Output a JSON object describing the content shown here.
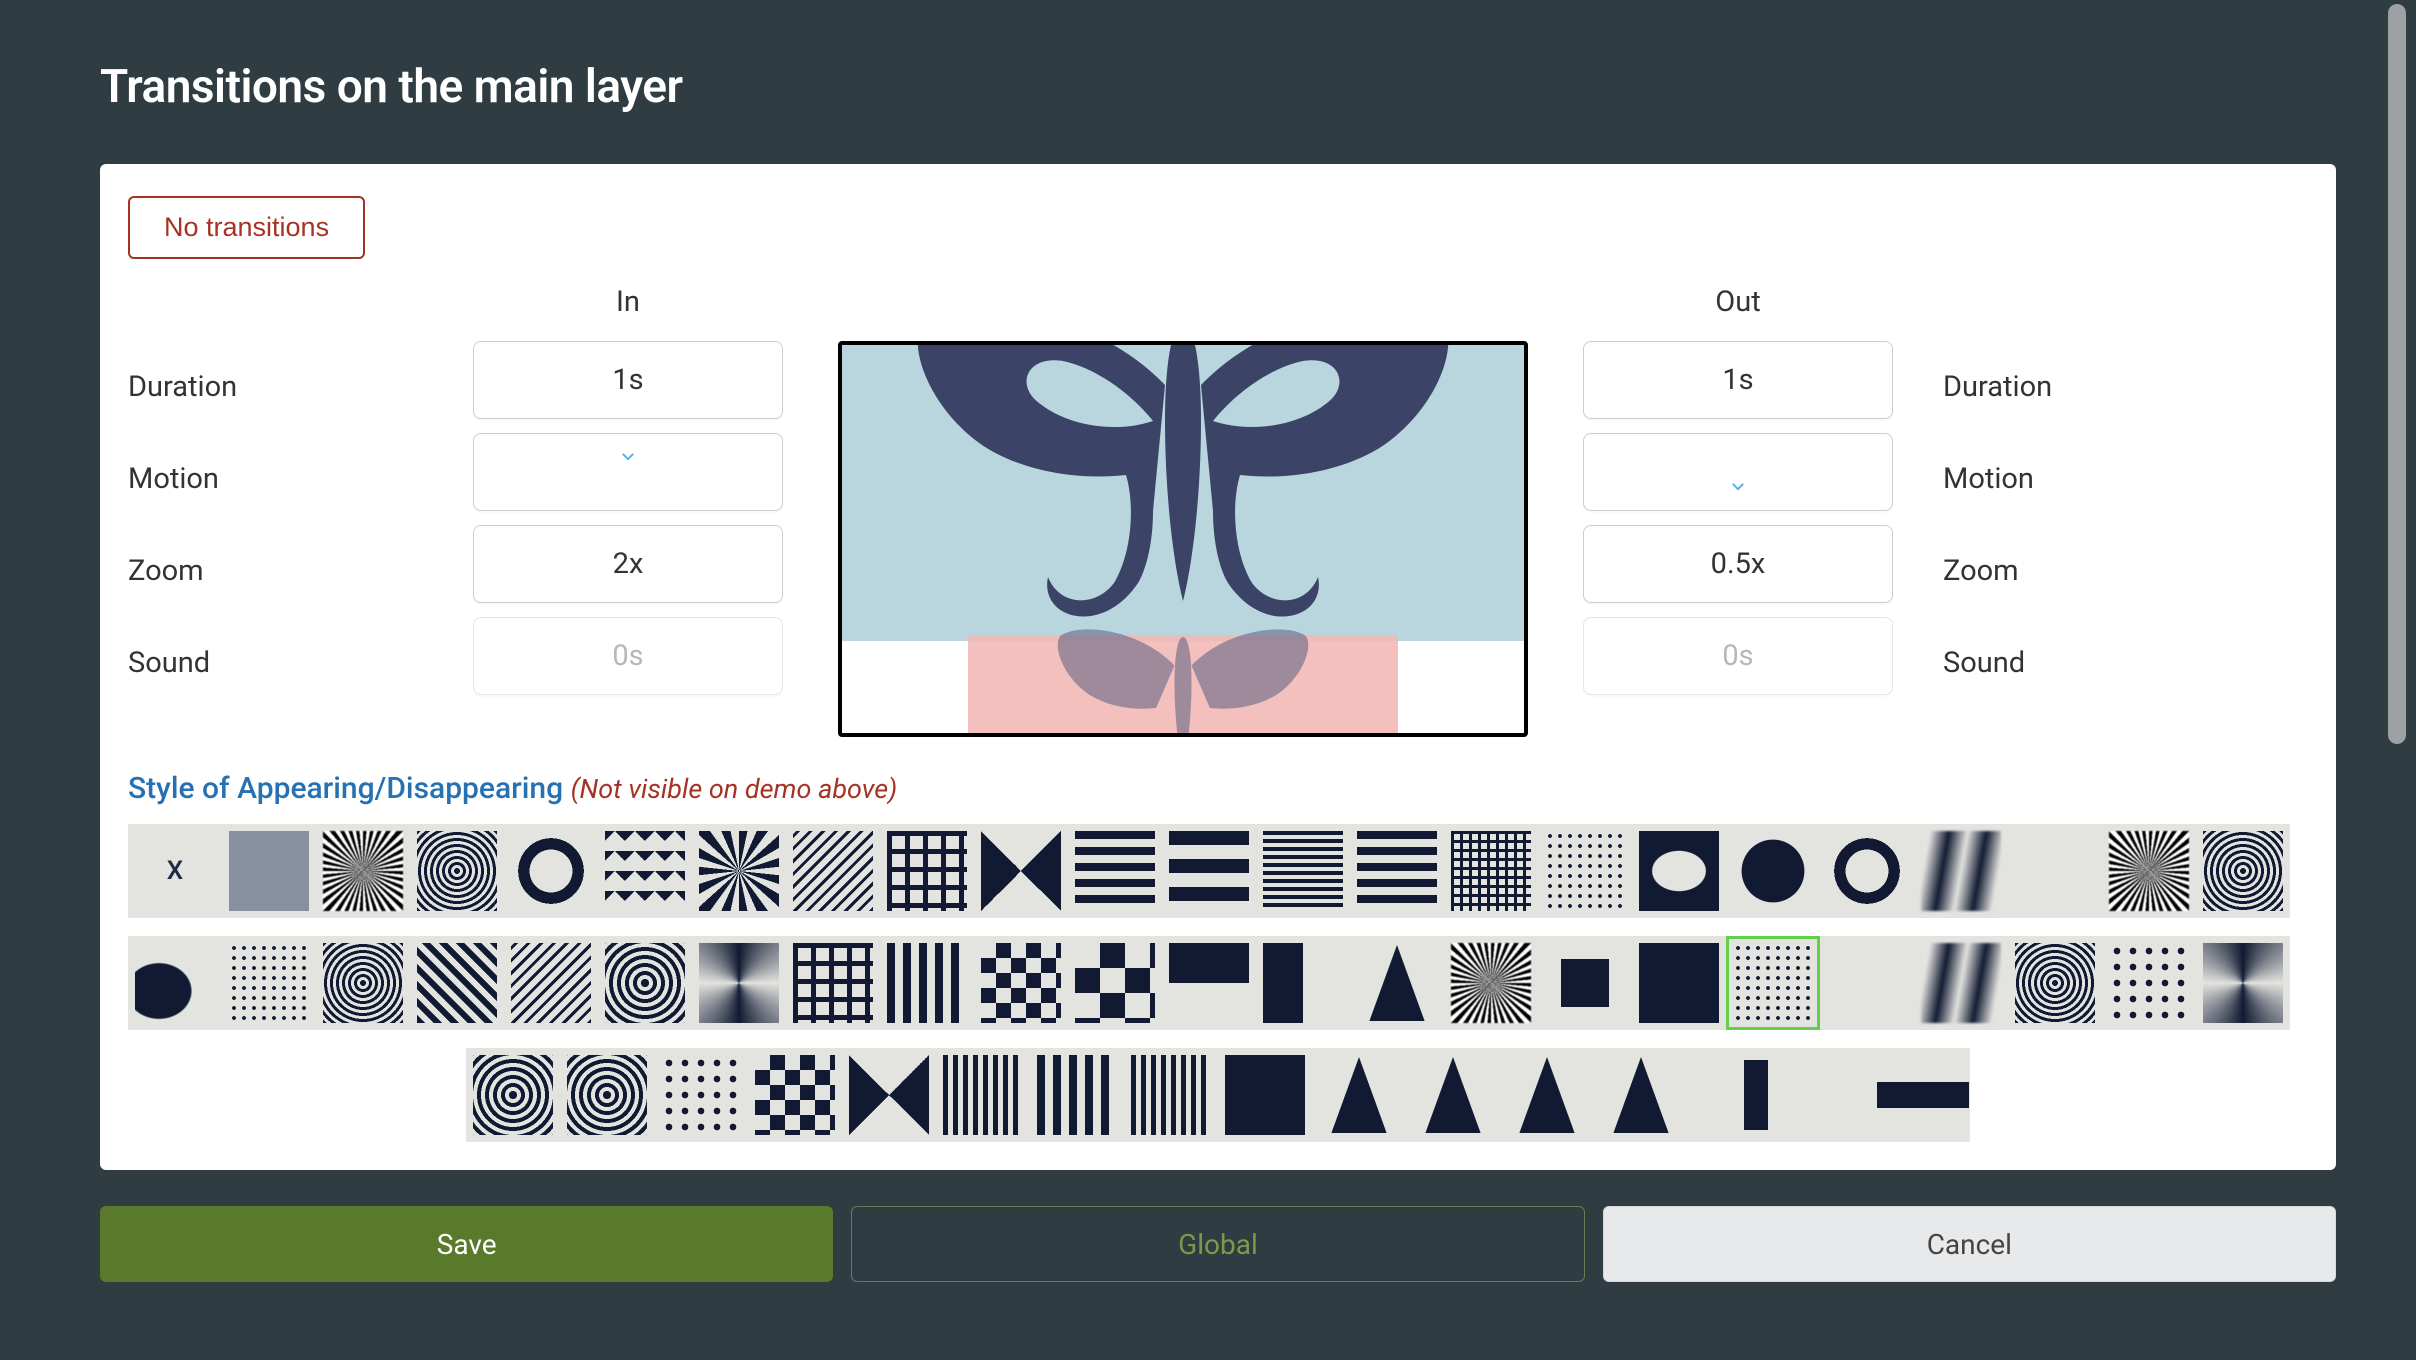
{
  "title": "Transitions on the main layer",
  "buttons": {
    "no_transitions": "No transitions",
    "save": "Save",
    "global": "Global",
    "cancel": "Cancel"
  },
  "columns": {
    "in": "In",
    "out": "Out"
  },
  "labels": {
    "duration": "Duration",
    "motion": "Motion",
    "zoom": "Zoom",
    "sound": "Sound"
  },
  "in": {
    "duration": "1s",
    "motion": "down",
    "zoom": "2x",
    "sound": "0s"
  },
  "out": {
    "duration": "1s",
    "motion": "down",
    "zoom": "0.5x",
    "sound": "0s"
  },
  "style": {
    "title": "Style of Appearing/Disappearing",
    "note": "(Not visible on demo above)",
    "selected_index": 40,
    "tiles": [
      {
        "id": "none",
        "label": "X",
        "pattern": "x"
      },
      {
        "id": "fade",
        "pattern": "p-solid-gray"
      },
      {
        "id": "noise-a",
        "pattern": "p-noise"
      },
      {
        "id": "noise-b",
        "pattern": "p-noise2"
      },
      {
        "id": "ring",
        "pattern": "p-ring"
      },
      {
        "id": "zigzag",
        "pattern": "p-zigzag"
      },
      {
        "id": "burst",
        "pattern": "p-burst"
      },
      {
        "id": "diag-fine",
        "pattern": "p-diag2"
      },
      {
        "id": "grid-a",
        "pattern": "p-grid"
      },
      {
        "id": "star",
        "pattern": "p-star"
      },
      {
        "id": "hstripe-a",
        "pattern": "p-hstripes"
      },
      {
        "id": "hstripe-b",
        "pattern": "p-hstripes-wide"
      },
      {
        "id": "hstripe-c",
        "pattern": "p-hstripes-fine"
      },
      {
        "id": "hstripe-d",
        "pattern": "p-hstripes"
      },
      {
        "id": "grid-b",
        "pattern": "p-grid-fine"
      },
      {
        "id": "dots-a",
        "pattern": "p-dots-fine"
      },
      {
        "id": "ellipse-a",
        "pattern": "p-ellipse"
      },
      {
        "id": "circle-a",
        "pattern": "p-circle"
      },
      {
        "id": "ring-b",
        "pattern": "p-ring"
      },
      {
        "id": "smear-a",
        "pattern": "p-smear"
      },
      {
        "id": "blank-a",
        "pattern": "p-blank"
      },
      {
        "id": "noise-c",
        "pattern": "p-noise"
      },
      {
        "id": "noise-d",
        "pattern": "p-noise2"
      },
      {
        "id": "blob",
        "pattern": "p-blob"
      },
      {
        "id": "dots-b",
        "pattern": "p-dots-fine"
      },
      {
        "id": "noise-e",
        "pattern": "p-noise2"
      },
      {
        "id": "diag-a",
        "pattern": "p-diag"
      },
      {
        "id": "diag-b",
        "pattern": "p-diag2"
      },
      {
        "id": "spiral-a",
        "pattern": "p-spiral"
      },
      {
        "id": "spiral-b",
        "pattern": "p-spiral2"
      },
      {
        "id": "grid-c",
        "pattern": "p-grid"
      },
      {
        "id": "vstripe-a",
        "pattern": "p-vstripes"
      },
      {
        "id": "checker-a",
        "pattern": "p-checker"
      },
      {
        "id": "checker-b",
        "pattern": "p-checker-big"
      },
      {
        "id": "quarter",
        "pattern": "p-quarter"
      },
      {
        "id": "half-v",
        "pattern": "p-half-v"
      },
      {
        "id": "tri-a",
        "pattern": "p-tri"
      },
      {
        "id": "noise-f",
        "pattern": "p-noise"
      },
      {
        "id": "square-a",
        "pattern": "p-square"
      },
      {
        "id": "solid",
        "pattern": ""
      },
      {
        "id": "static",
        "pattern": "p-dots-fine"
      },
      {
        "id": "blank-b",
        "pattern": "p-blank"
      },
      {
        "id": "smear-b",
        "pattern": "p-smear"
      },
      {
        "id": "noise-g",
        "pattern": "p-noise2"
      },
      {
        "id": "dots-c",
        "pattern": "p-dots"
      },
      {
        "id": "spiral-c",
        "pattern": "p-spiral2"
      },
      {
        "id": "spiral-d",
        "pattern": "p-spiral"
      },
      {
        "id": "spiral-e",
        "pattern": "p-spiral"
      },
      {
        "id": "dots-d",
        "pattern": "p-dots"
      },
      {
        "id": "checker-c",
        "pattern": "p-checker"
      },
      {
        "id": "star-b",
        "pattern": "p-star"
      },
      {
        "id": "vstripe-b",
        "pattern": "p-vstripes-fine"
      },
      {
        "id": "vstripe-c",
        "pattern": "p-vstripes"
      },
      {
        "id": "vstripe-d",
        "pattern": "p-vstripes-fine"
      },
      {
        "id": "solid-b",
        "pattern": ""
      },
      {
        "id": "tri-b",
        "pattern": "p-tri"
      },
      {
        "id": "tri-c",
        "pattern": "p-tri"
      },
      {
        "id": "tri-d",
        "pattern": "p-tri"
      },
      {
        "id": "tri-e",
        "pattern": "p-tri"
      },
      {
        "id": "twobars",
        "pattern": "p-twobars"
      },
      {
        "id": "blank-c",
        "pattern": "p-blank"
      },
      {
        "id": "centerbar",
        "pattern": "p-centerbar"
      }
    ],
    "row_lengths": [
      23,
      23,
      16
    ]
  }
}
